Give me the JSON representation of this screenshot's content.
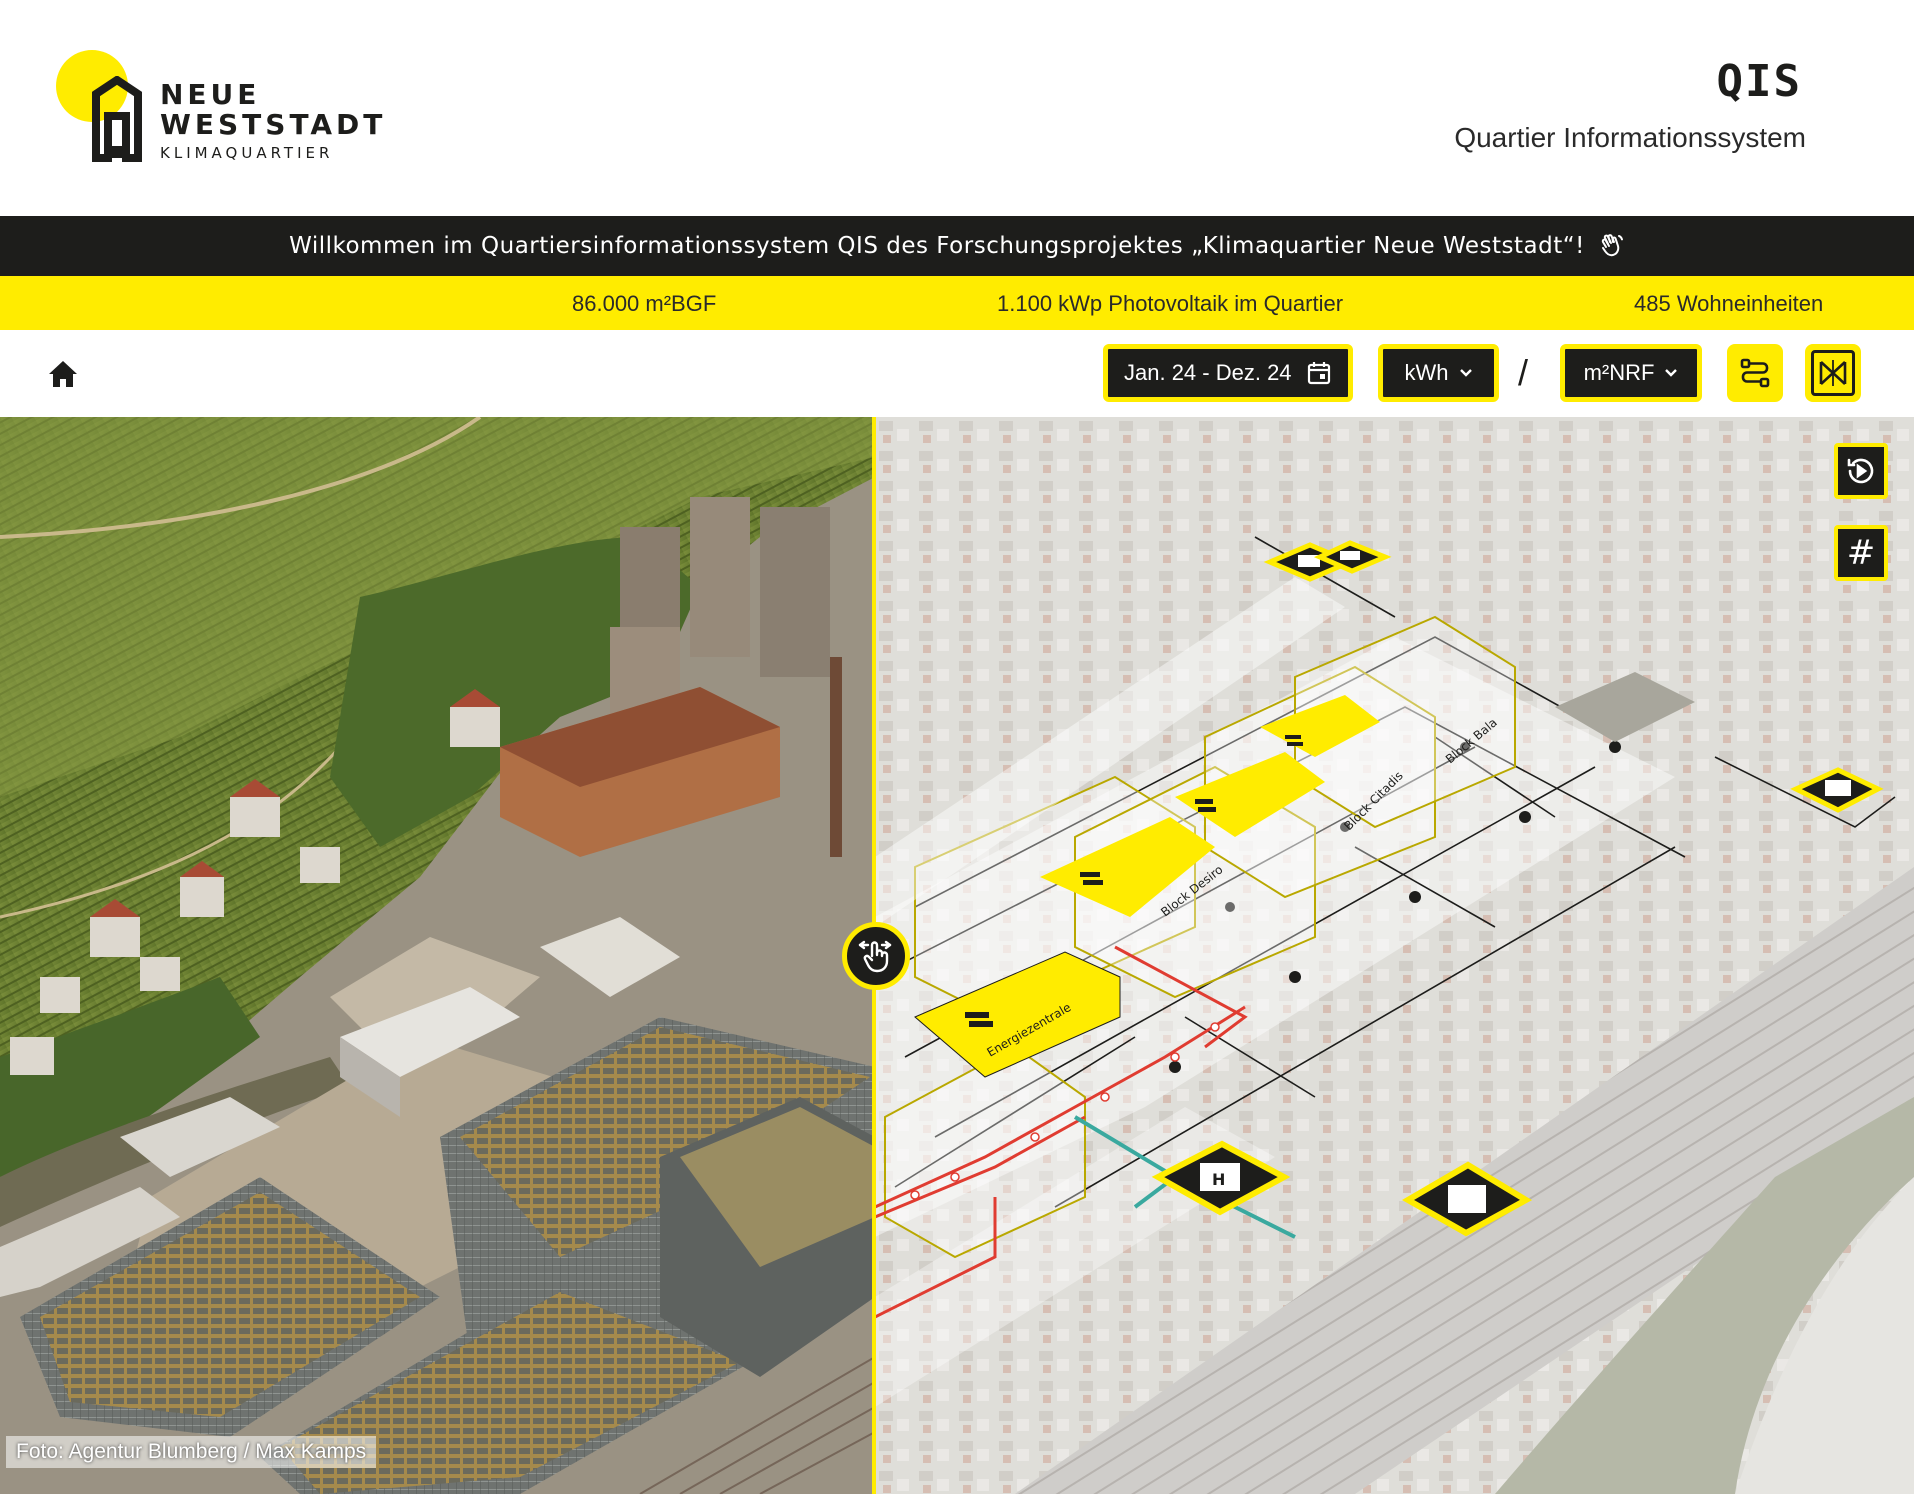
{
  "header": {
    "logo": {
      "line1": "NEUE",
      "line2": "WESTSTADT",
      "line3": "KLIMAQUARTIER",
      "accent_color": "#ffec00"
    },
    "title": "QIS",
    "subtitle": "Quartier Informationssystem"
  },
  "banner": {
    "text": "Willkommen im Quartiersinformationssystem QIS des Forschungsprojektes „Klimaquartier Neue Weststadt“!",
    "icon": "waving-hand-icon"
  },
  "stats": [
    {
      "text": "86.000 m²BGF"
    },
    {
      "text": "1.100 kWp Photovoltaik im Quartier"
    },
    {
      "text": "485 Wohneinheiten"
    }
  ],
  "toolbar": {
    "home_icon": "home-icon",
    "date_range": "Jan. 24 - Dez. 24",
    "unit": "kWh",
    "separator": "/",
    "reference": "m²NRF",
    "route_icon": "route-icon",
    "compare_icon": "compare-icon"
  },
  "map": {
    "credit": "Foto: Agentur Blumberg / Max Kamps",
    "side_buttons": {
      "history_icon": "history-icon",
      "grid_label": "#"
    },
    "blocks": [
      {
        "label": "Energiezentrale"
      },
      {
        "label": "Block Desiro"
      },
      {
        "label": "Block Citadis"
      },
      {
        "label": "Block Bala"
      }
    ],
    "swipe_icon": "swipe-hand-icon"
  },
  "colors": {
    "yellow": "#ffec00",
    "dark": "#1d1d1b",
    "heat_red": "#e03c31",
    "cold_teal": "#3aa99f"
  }
}
